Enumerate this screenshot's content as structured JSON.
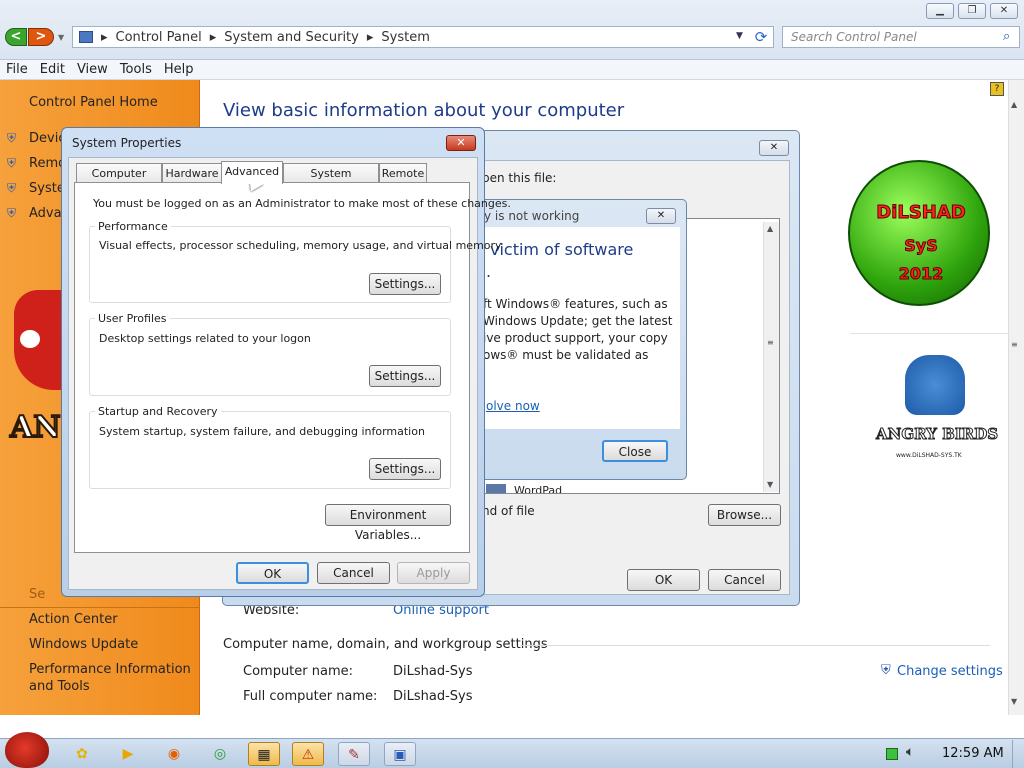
{
  "window": {
    "min": "▁",
    "max": "❐",
    "close": "✕"
  },
  "breadcrumb": [
    "Control Panel",
    "System and Security",
    "System"
  ],
  "search": {
    "placeholder": "Search Control Panel"
  },
  "menu": [
    "File",
    "Edit",
    "View",
    "Tools",
    "Help"
  ],
  "left_panel": {
    "home": "Control Panel Home",
    "links_partial": [
      "Devic",
      "Remo",
      "Syste",
      "Adva"
    ],
    "see_also_partial": "Se",
    "see_also": [
      "Action Center",
      "Windows Update",
      "Performance Information",
      "and Tools"
    ]
  },
  "main": {
    "title": "View basic information about your computer",
    "website_label": "Website:",
    "website_value": "Online support",
    "section": "Computer name, domain, and workgroup settings",
    "computer_name_label": "Computer name:",
    "computer_name_value": "DiLshad-Sys",
    "full_name_label": "Full computer name:",
    "full_name_value": "DiLshad-Sys",
    "change_settings": "Change settings"
  },
  "logos": {
    "green_badge": [
      "DiLSHAD",
      "SyS",
      "2012"
    ],
    "angry_birds_text": "ANGRY BIRDS",
    "watermark": "www.DiLSHAD-SYS.TK",
    "left_partial": "ANG"
  },
  "open_with_dialog": {
    "text1": "pen this file:",
    "text2": "nd of file",
    "browse": "Browse...",
    "ok": "OK",
    "cancel": "Cancel",
    "item_partial": "WordPad"
  },
  "activation_dialog": {
    "title_partial": "y is not working",
    "heading1": "victim of software",
    "heading2": ".",
    "body": [
      "ft Windows® features, such as",
      "Windows Update; get the latest",
      "ive product support, your copy",
      "ows® must be validated as"
    ],
    "link": "olve now",
    "close": "Close"
  },
  "system_properties": {
    "title": "System Properties",
    "tabs": [
      "Computer Name",
      "Hardware",
      "Advanced",
      "System Protection",
      "Remote"
    ],
    "admin_note": "You must be logged on as an Administrator to make most of these changes.",
    "groups": [
      {
        "title": "Performance",
        "text": "Visual effects, processor scheduling, memory usage, and virtual memory",
        "button": "Settings..."
      },
      {
        "title": "User Profiles",
        "text": "Desktop settings related to your logon",
        "button": "Settings..."
      },
      {
        "title": "Startup and Recovery",
        "text": "System startup, system failure, and debugging information",
        "button": "Settings..."
      }
    ],
    "env_button": "Environment Variables...",
    "ok": "OK",
    "cancel": "Cancel",
    "apply": "Apply"
  },
  "taskbar": {
    "clock": "12:59 AM"
  }
}
